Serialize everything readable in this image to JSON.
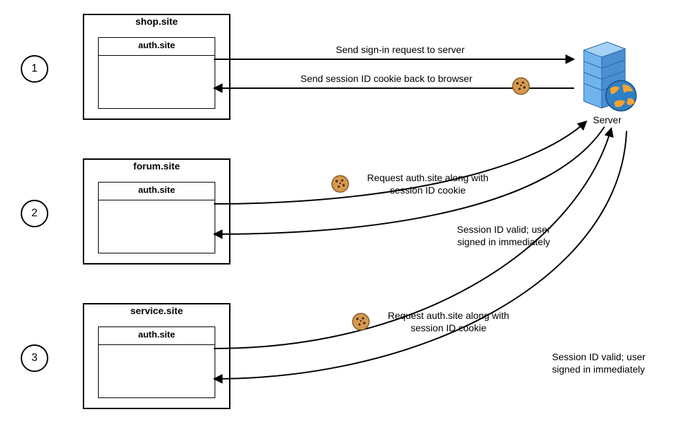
{
  "steps": {
    "1": {
      "number": "1",
      "outer": "shop.site",
      "inner": "auth.site"
    },
    "2": {
      "number": "2",
      "outer": "forum.site",
      "inner": "auth.site"
    },
    "3": {
      "number": "3",
      "outer": "service.site",
      "inner": "auth.site"
    }
  },
  "server": {
    "label": "Server"
  },
  "labels": {
    "l1_req": "Send sign-in request to server",
    "l1_resp": "Send session ID cookie back to browser",
    "l2_req": "Request auth.site along with\nsession ID cookie",
    "l2_resp": "Session ID valid; user\nsigned in immediately",
    "l3_req": "Request auth.site along with\nsession ID cookie",
    "l3_resp": "Session ID valid; user\nsigned in immediately"
  }
}
